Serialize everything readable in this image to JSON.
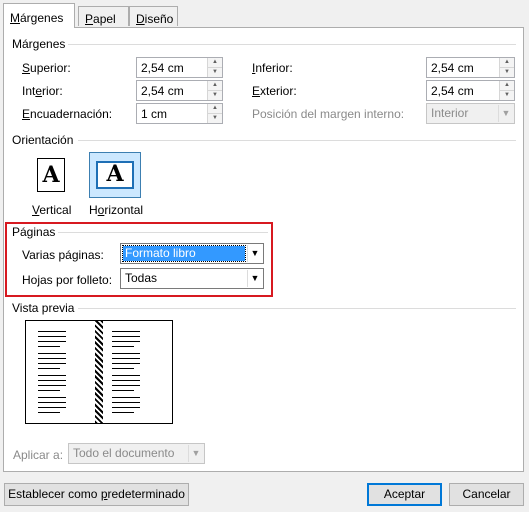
{
  "tabs": [
    {
      "label": "Márgenes",
      "underline": "M",
      "rest": "árgenes"
    },
    {
      "label": "Papel",
      "underline": "P",
      "rest": "apel"
    },
    {
      "label": "Diseño",
      "underline": "D",
      "rest": "iseño"
    }
  ],
  "margins": {
    "title": "Márgenes",
    "top": {
      "label_u": "S",
      "label_rest": "uperior:",
      "value": "2,54 cm"
    },
    "bottom": {
      "label_u": "I",
      "label_rest": "nferior:",
      "value": "2,54 cm"
    },
    "inner": {
      "label_pre": "Int",
      "label_u": "e",
      "label_rest": "rior:",
      "value": "2,54 cm"
    },
    "outer": {
      "label_u": "E",
      "label_rest": "xterior:",
      "value": "2,54 cm"
    },
    "gutter": {
      "label_u": "E",
      "label_rest": "ncuadernación:",
      "value": "1 cm"
    },
    "gutter_pos": {
      "label": "Posición del margen interno:",
      "value": "Interior"
    }
  },
  "orientation": {
    "title": "Orientación",
    "vertical": {
      "label_u": "V",
      "label_rest": "ertical",
      "glyph": "A"
    },
    "horizontal": {
      "label_pre": "H",
      "label_u": "o",
      "label_rest": "rizontal",
      "glyph": "A"
    }
  },
  "pages": {
    "title": "Páginas",
    "multiple": {
      "label_pre": "Varias pá",
      "label_u": "g",
      "label_rest": "inas:",
      "value": "Formato libro"
    },
    "sheets": {
      "label_pre": "Hojas por folleto:",
      "value": "Todas"
    }
  },
  "preview": {
    "title": "Vista previa"
  },
  "apply": {
    "label": "Aplicar a:",
    "value": "Todo el documento"
  },
  "buttons": {
    "default_pre": "Establecer como ",
    "default_u": "p",
    "default_rest": "redeterminado",
    "ok": "Aceptar",
    "cancel": "Cancelar"
  },
  "colors": {
    "highlight": "#d71920",
    "selection": "#3399ff",
    "accent": "#0078d7"
  }
}
